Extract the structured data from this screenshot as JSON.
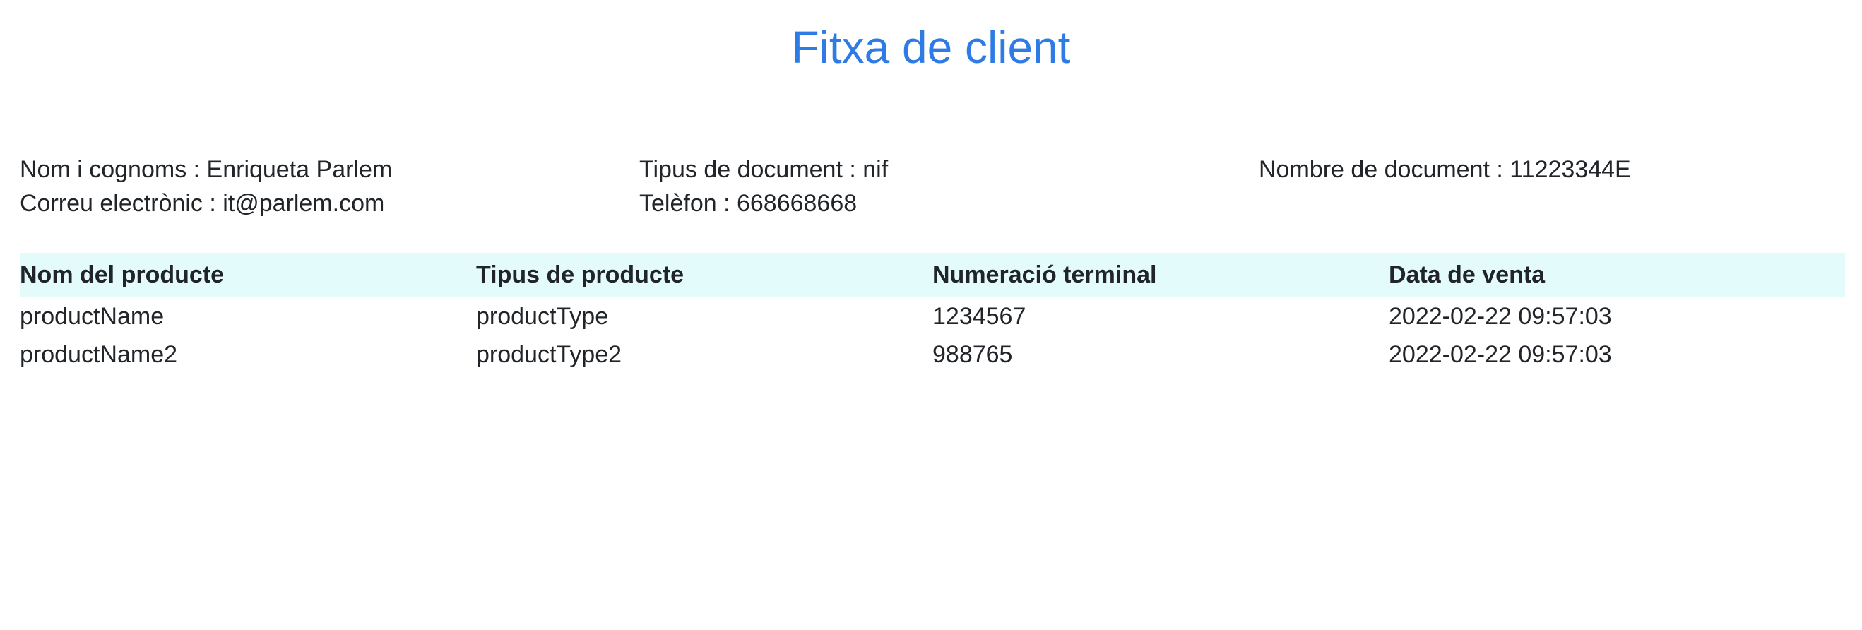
{
  "header": {
    "title": "Fitxa de client"
  },
  "client": {
    "name": {
      "label": "Nom i cognoms",
      "value": "Enriqueta Parlem",
      "text": "Nom i cognoms : Enriqueta Parlem"
    },
    "document_type": {
      "label": "Tipus de document",
      "value": "nif",
      "text": "Tipus de document : nif"
    },
    "document_number": {
      "label": "Nombre de document",
      "value": "11223344E",
      "text": "Nombre de document : 11223344E"
    },
    "email": {
      "label": "Correu electrònic",
      "value": "it@parlem.com",
      "text": "Correu electrònic : it@parlem.com"
    },
    "phone": {
      "label": "Telèfon",
      "value": "668668668",
      "text": "Telèfon : 668668668"
    }
  },
  "products_table": {
    "columns": [
      "Nom del producte",
      "Tipus de producte",
      "Numeració terminal",
      "Data de venta"
    ],
    "header_bg": "#e3fcfb",
    "rows": [
      [
        "productName",
        "productType",
        "1234567",
        "2022-02-22 09:57:03"
      ],
      [
        "productName2",
        "productType2",
        "988765",
        "2022-02-22 09:57:03"
      ]
    ]
  },
  "colors": {
    "title": "#2f7be5",
    "text": "#212529"
  }
}
